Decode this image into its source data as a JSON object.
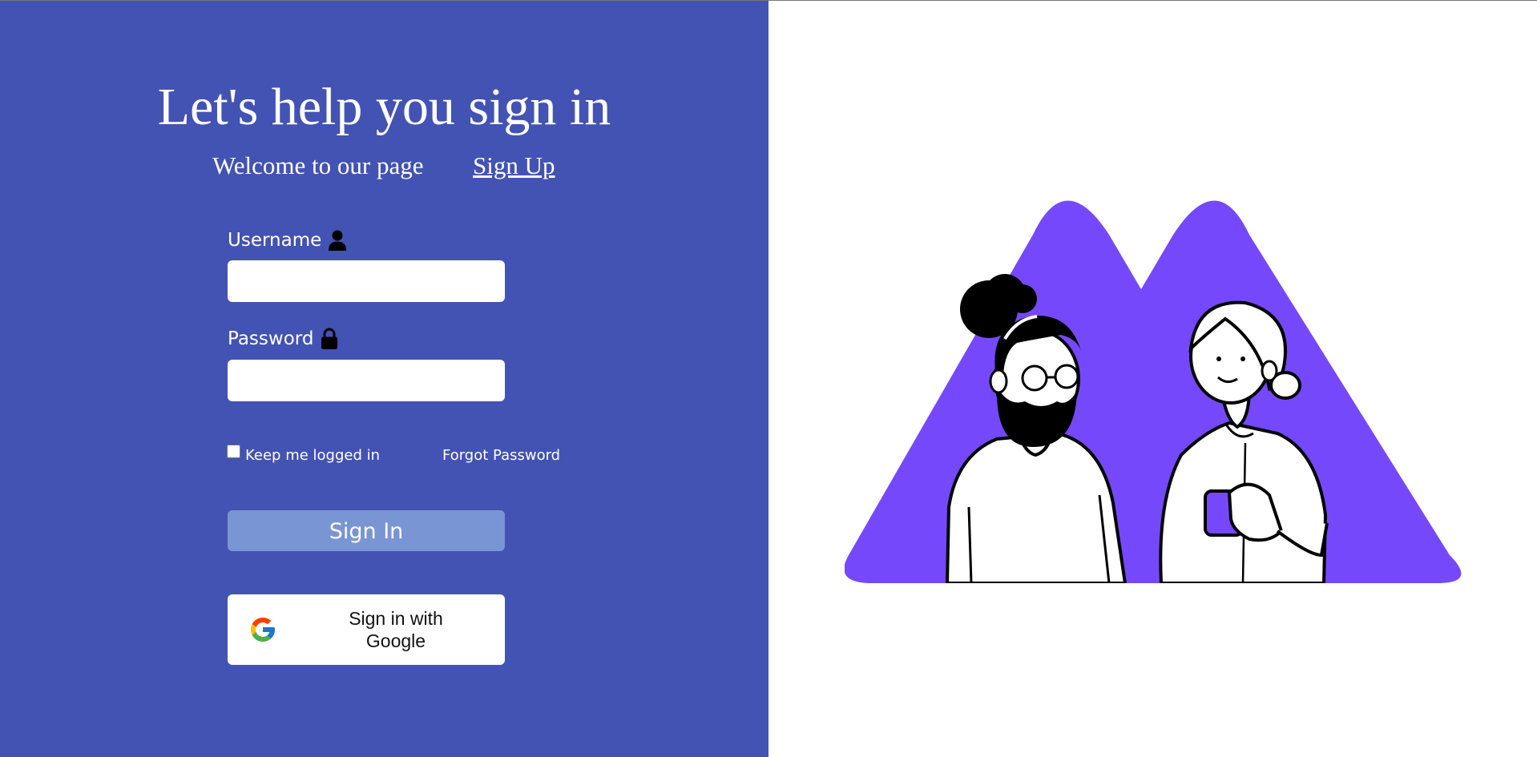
{
  "header": {
    "title": "Let's help you sign in",
    "welcome": "Welcome to our page",
    "signup_link": "Sign Up"
  },
  "form": {
    "username_label": "Username",
    "username_icon": "user-icon",
    "username_value": "",
    "password_label": "Password",
    "password_icon": "lock-icon",
    "password_value": "",
    "keep_logged_in_label": "Keep me logged in",
    "keep_logged_in_checked": false,
    "forgot_password": "Forgot Password",
    "signin_button": "Sign In",
    "google_button": "Sign in with Google",
    "google_icon": "google-logo-icon"
  },
  "illustration": {
    "name": "two-people-talking-illustration"
  },
  "colors": {
    "left_panel_bg": "#4353b3",
    "signin_button_bg": "#7a95d4",
    "illustration_purple": "#7549fb",
    "white": "#ffffff"
  }
}
